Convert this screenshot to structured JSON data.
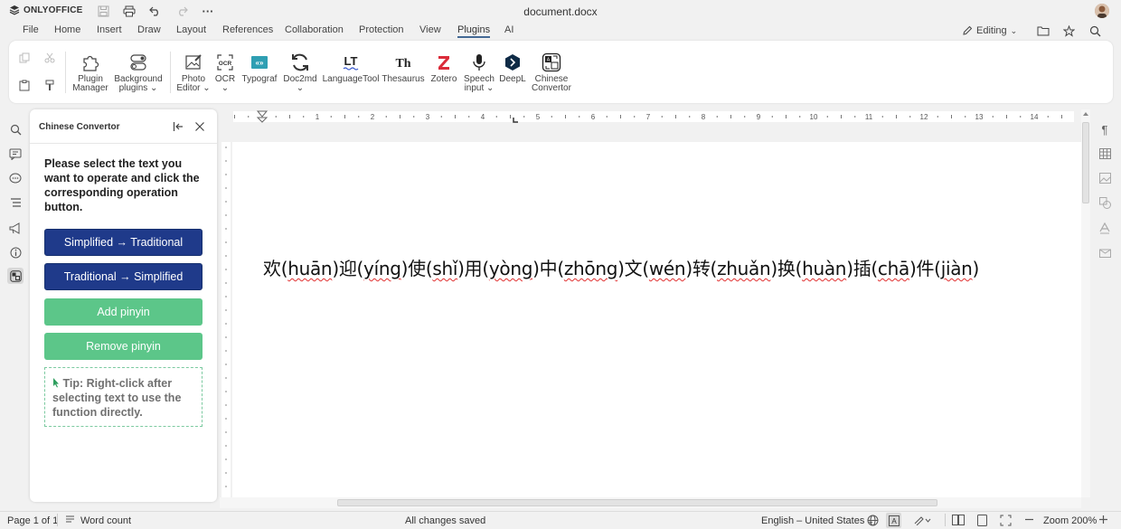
{
  "app": {
    "logo_text": "ONLYOFFICE",
    "document_title": "document.docx"
  },
  "menu": {
    "tabs": [
      "File",
      "Home",
      "Insert",
      "Draw",
      "Layout",
      "References",
      "Collaboration",
      "Protection",
      "View",
      "Plugins",
      "AI"
    ],
    "active_tab": "Plugins",
    "mode_label": "Editing"
  },
  "toolbar": {
    "plugins": [
      {
        "label1": "Plugin",
        "label2": "Manager",
        "icon": "puzzle-icon"
      },
      {
        "label1": "Background",
        "label2": "plugins ⌄",
        "icon": "toggle-icon"
      },
      {
        "label1": "Photo",
        "label2": "Editor ⌄",
        "icon": "photo-editor-icon"
      },
      {
        "label1": "OCR",
        "label2": "⌄",
        "icon": "ocr-icon"
      },
      {
        "label1": "Typograf",
        "label2": "",
        "icon": "typograf-icon"
      },
      {
        "label1": "Doc2md",
        "label2": "⌄",
        "icon": "doc2md-icon"
      },
      {
        "label1": "LanguageTool",
        "label2": "",
        "icon": "languagetool-icon"
      },
      {
        "label1": "Thesaurus",
        "label2": "",
        "icon": "thesaurus-icon"
      },
      {
        "label1": "Zotero",
        "label2": "",
        "icon": "zotero-icon"
      },
      {
        "label1": "Speech",
        "label2": "input ⌄",
        "icon": "microphone-icon"
      },
      {
        "label1": "DeepL",
        "label2": "",
        "icon": "deepl-icon"
      },
      {
        "label1": "Chinese",
        "label2": "Convertor",
        "icon": "chinese-convertor-icon"
      }
    ]
  },
  "panel": {
    "title": "Chinese Convertor",
    "instructions": "Please select the text you want to operate and click the corresponding operation button.",
    "buttons": {
      "s2t": "Simplified → Traditional",
      "t2s": "Traditional → Simplified",
      "add_pinyin": "Add pinyin",
      "remove_pinyin": "Remove pinyin"
    },
    "tip": "Tip: Right-click after selecting text to use the function directly."
  },
  "document": {
    "segments": [
      {
        "han": "欢",
        "pinyin": "huān"
      },
      {
        "han": "迎",
        "pinyin": "yíng"
      },
      {
        "han": "使",
        "pinyin": "shǐ"
      },
      {
        "han": "用",
        "pinyin": "yòng"
      },
      {
        "han": "中",
        "pinyin": "zhōng"
      },
      {
        "han": "文",
        "pinyin": "wén"
      },
      {
        "han": "转",
        "pinyin": "zhuǎn"
      },
      {
        "han": "换",
        "pinyin": "huàn"
      },
      {
        "han": "插",
        "pinyin": "chā"
      },
      {
        "han": "件",
        "pinyin": "jiàn"
      }
    ]
  },
  "ruler": {
    "numbers": [
      "1",
      "1",
      "2",
      "3",
      "4",
      "5",
      "6",
      "7",
      "8",
      "9",
      "10",
      "11",
      "12",
      "13",
      "14"
    ]
  },
  "status": {
    "page": "Page 1 of 1",
    "word_count": "Word count",
    "saved": "All changes saved",
    "language": "English – United States",
    "zoom": "Zoom 200%"
  },
  "colors": {
    "accent": "#446995",
    "blue_button": "#1f3a8a",
    "green_button": "#5cc689",
    "zotero_red": "#db2c3a"
  }
}
